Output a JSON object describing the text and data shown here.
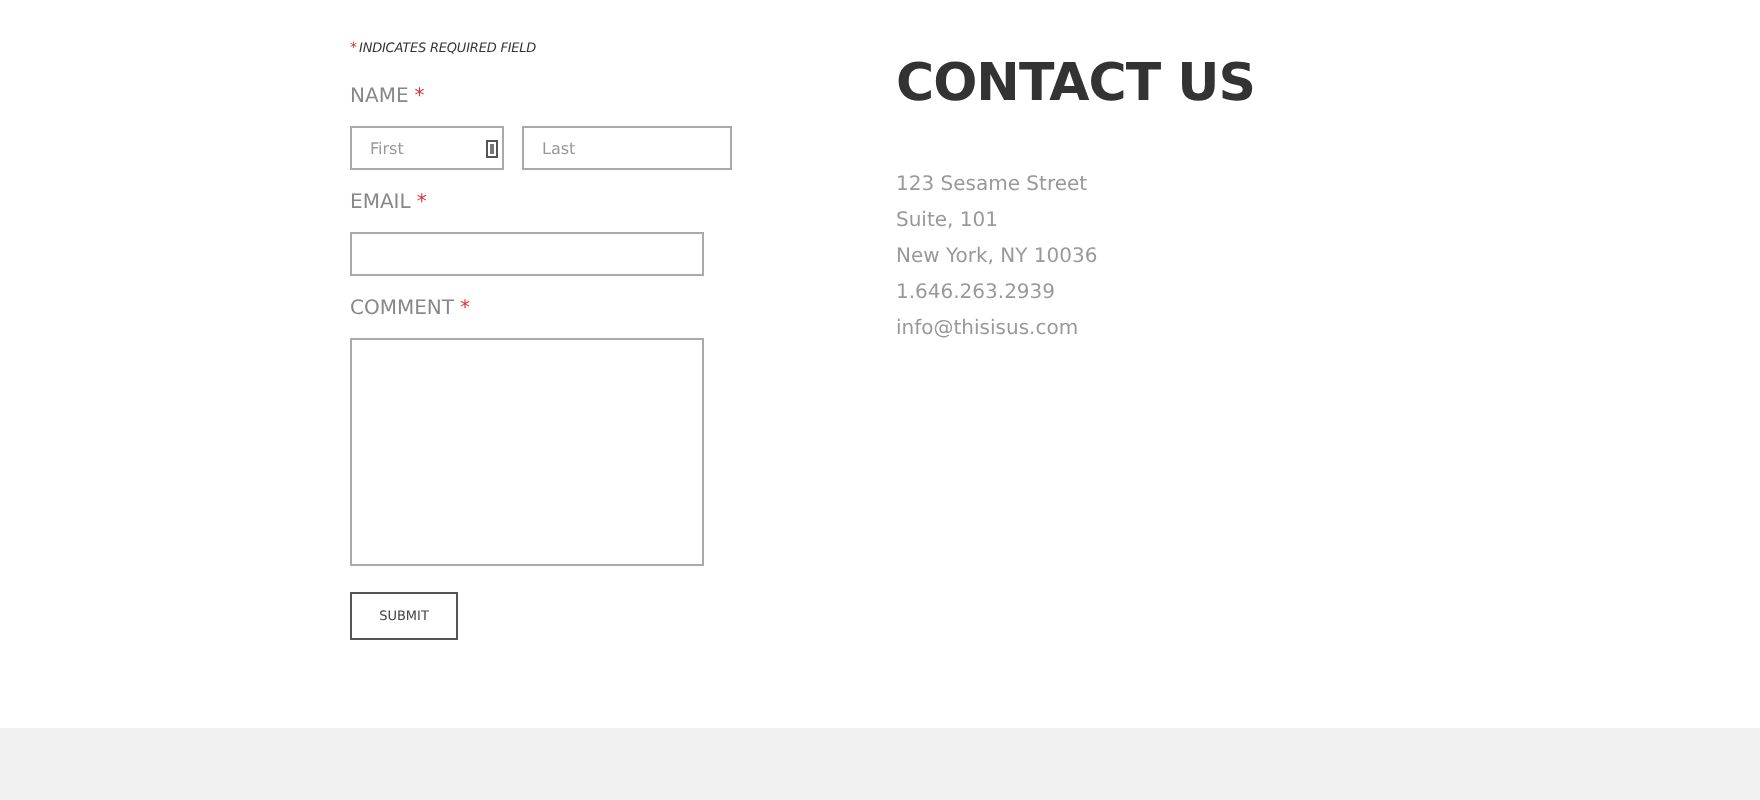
{
  "form": {
    "note_mark": "*",
    "note": "INDICATES REQUIRED FIELD",
    "fields": [
      {
        "kind": "name",
        "label": "NAME",
        "mark": "*",
        "inputs": [
          {
            "placeholder": "First"
          },
          {
            "placeholder": "Last"
          }
        ]
      },
      {
        "kind": "email",
        "label": "EMAIL",
        "mark": "*"
      },
      {
        "kind": "comment",
        "label": "COMMENT",
        "mark": "*"
      }
    ],
    "submit": "SUBMIT"
  },
  "contact": {
    "title": "CONTACT US",
    "lines": [
      "123 Sesame Street",
      "Suite, 101",
      "New York, NY 10036",
      "1.646.263.2939",
      "info@thisisus.com"
    ]
  }
}
